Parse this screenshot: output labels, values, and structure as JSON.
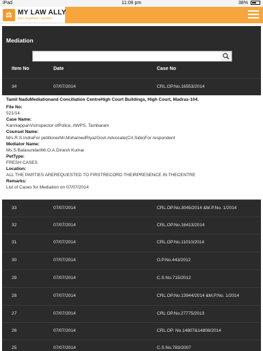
{
  "status_bar": {
    "device": "iPad",
    "time": "11:08 pm",
    "battery": "38%"
  },
  "app": {
    "name": "MY LAW ALLY",
    "tagline": "law • anywhere • anytime"
  },
  "page": {
    "title": "Mediation",
    "search_placeholder": "",
    "columns": [
      "Item No",
      "Date",
      "Case No"
    ]
  },
  "rows_before": [
    {
      "item": "34",
      "date": "07/07/2014",
      "case": "CRL.OP.No.16553/2014"
    }
  ],
  "detail": {
    "title": "Tamil NaduMediationand Conciliation CentreHigh Court Buildings, High Court, Madras-104.",
    "fields": [
      {
        "label": "File No:",
        "value": "521/14"
      },
      {
        "label": "Case Name:",
        "value": "KanniappanVsInspector ofPolice, AWPS, Tambaram"
      },
      {
        "label": "Counsel Name:",
        "value": "M/s.R.S.IndraFor petitionerMr.MohamedRiyazGovt.Advocate(Crl.Side)For respondent"
      },
      {
        "label": "Mediator Name:",
        "value": "Ms.S.BalasundariMr.O.A.Dinesh Kumar"
      },
      {
        "label": "PetType:",
        "value": "FRESH CASES"
      },
      {
        "label": "Location:",
        "value": "ALL THE PARTIES AREREQUESTED TO FIRSTRECORD THEIRPRESENCE IN THECENTRE"
      },
      {
        "label": "Remarks:",
        "value": "List of Cases for Mediation on 07/07/2014"
      }
    ]
  },
  "rows_after": [
    {
      "item": "33",
      "date": "07/07/2014",
      "case": "CRL.OP.No.3045/2014 &M.P.No. 1/2014"
    },
    {
      "item": "32",
      "date": "07/07/2014",
      "case": "CRL.OP.No.16413/2014"
    },
    {
      "item": "31",
      "date": "07/07/2014",
      "case": "CRL.OP.No.11010/2014"
    },
    {
      "item": "30",
      "date": "07/07/2014",
      "case": "O.P.No.443/2012"
    },
    {
      "item": "29",
      "date": "07/07/2014",
      "case": "C.S.No.715/2012"
    },
    {
      "item": "28",
      "date": "07/07/2014",
      "case": "CRL.OP.No.13944/2014 &M.P.No. 1/2014"
    },
    {
      "item": "27",
      "date": "07/07/2014",
      "case": "CRL OP.No.27775/2013"
    },
    {
      "item": "26",
      "date": "07/07/2014",
      "case": "CRL.OP. No.14807&14808/2014"
    },
    {
      "item": "25",
      "date": "07/07/2014",
      "case": "C.S.No.783/2007"
    }
  ]
}
